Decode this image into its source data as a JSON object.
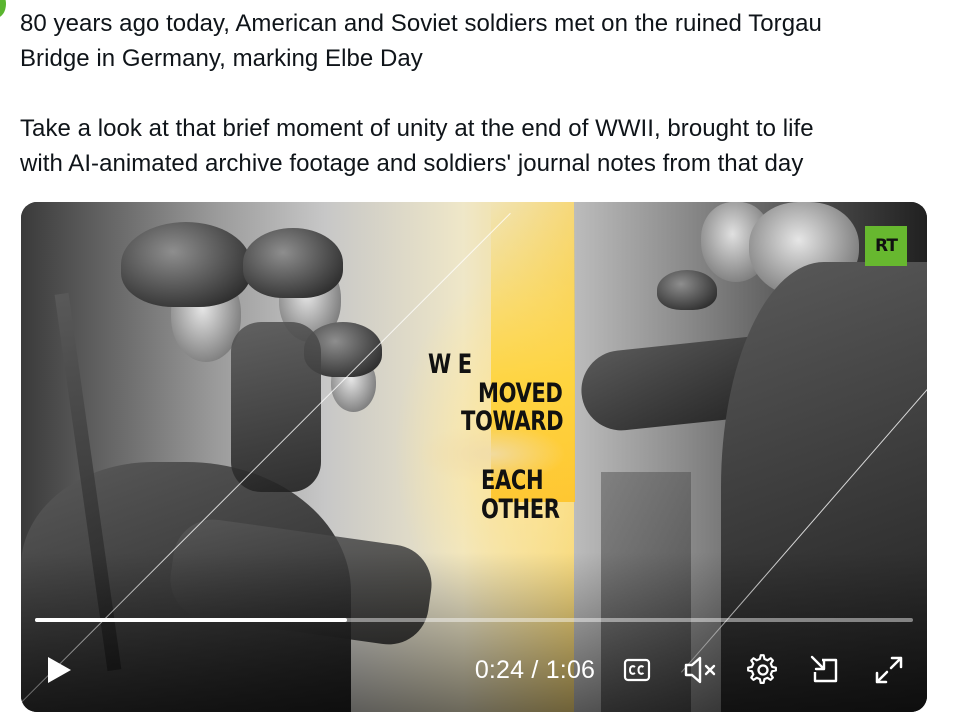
{
  "tweet": {
    "line1": "80 years ago today, American and Soviet soldiers met on the ruined Torgau",
    "line2": "Bridge in Germany, marking Elbe Day",
    "line3": "Take a look at that brief moment of unity at the end of WWII, brought to life",
    "line4": "with AI-animated archive footage and soldiers' journal notes from that day"
  },
  "video": {
    "overlay_lines": [
      "W E",
      "MOVED",
      "TOWARD",
      "EACH",
      "OTHER"
    ],
    "logo": "RT",
    "progress_percent": 35.5,
    "time_display": "0:24 / 1:06",
    "icons": {
      "play": "play-icon",
      "captions": "closed-captions-icon",
      "mute": "muted-volume-icon",
      "settings": "gear-icon",
      "dock": "picture-in-picture-icon",
      "fullscreen": "fullscreen-icon"
    },
    "colors": {
      "logo_green": "#67b82f",
      "accent_yellow": "#f6d87a"
    }
  }
}
